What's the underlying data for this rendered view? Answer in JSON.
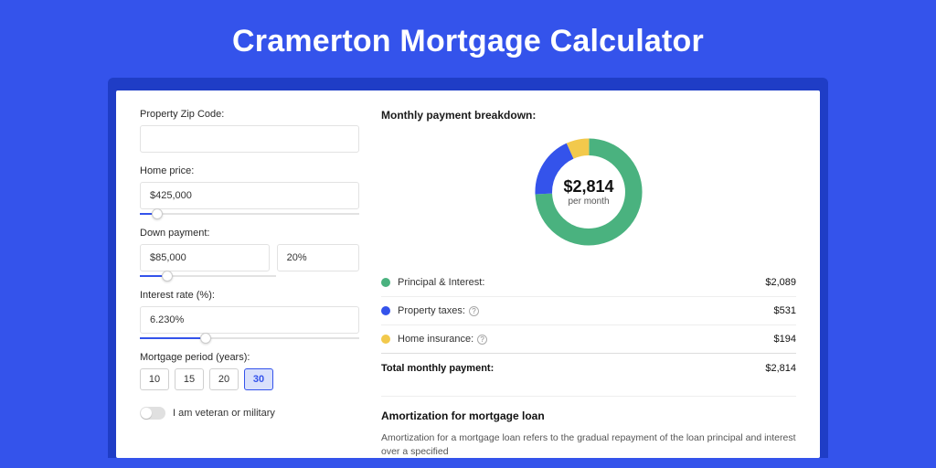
{
  "title": "Cramerton Mortgage Calculator",
  "form": {
    "zip_label": "Property Zip Code:",
    "zip_value": "",
    "home_price_label": "Home price:",
    "home_price_value": "$425,000",
    "home_price_slider_pct": 8,
    "down_payment_label": "Down payment:",
    "down_payment_value": "$85,000",
    "down_payment_pct_value": "20%",
    "down_payment_slider_pct": 20,
    "interest_label": "Interest rate (%):",
    "interest_value": "6.230%",
    "interest_slider_pct": 30,
    "period_label": "Mortgage period (years):",
    "periods": [
      "10",
      "15",
      "20",
      "30"
    ],
    "period_selected_index": 3,
    "veteran_label": "I am veteran or military"
  },
  "breakdown": {
    "title": "Monthly payment breakdown:",
    "center_amount": "$2,814",
    "center_sub": "per month",
    "items": [
      {
        "label": "Principal & Interest:",
        "value": "$2,089",
        "color": "#4ab27f",
        "help": false
      },
      {
        "label": "Property taxes:",
        "value": "$531",
        "color": "#3453eb",
        "help": true
      },
      {
        "label": "Home insurance:",
        "value": "$194",
        "color": "#f2c94c",
        "help": true
      }
    ],
    "total_label": "Total monthly payment:",
    "total_value": "$2,814"
  },
  "chart_data": {
    "type": "pie",
    "title": "Monthly payment breakdown",
    "series": [
      {
        "name": "Principal & Interest",
        "value": 2089,
        "color": "#4ab27f"
      },
      {
        "name": "Property taxes",
        "value": 531,
        "color": "#3453eb"
      },
      {
        "name": "Home insurance",
        "value": 194,
        "color": "#f2c94c"
      }
    ],
    "total": 2814
  },
  "amortization": {
    "title": "Amortization for mortgage loan",
    "text": "Amortization for a mortgage loan refers to the gradual repayment of the loan principal and interest over a specified"
  }
}
